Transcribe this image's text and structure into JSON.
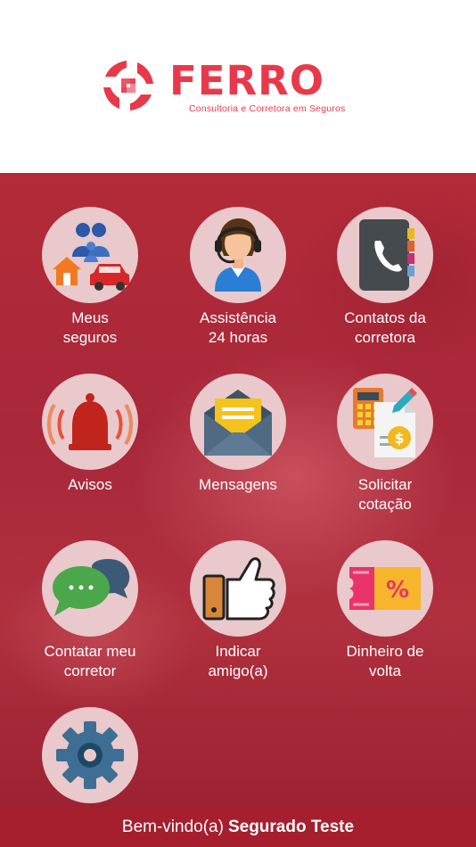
{
  "brand": {
    "name": "FERRO",
    "tagline": "Consultoria e Corretora em Seguros",
    "color": "#e8394a"
  },
  "menu": [
    {
      "line1": "Meus",
      "line2": "seguros",
      "icon": "family-house-car-icon"
    },
    {
      "line1": "Assistência",
      "line2": "24 horas",
      "icon": "headset-agent-icon"
    },
    {
      "line1": "Contatos da",
      "line2": "corretora",
      "icon": "phone-book-icon"
    },
    {
      "line1": "Avisos",
      "line2": "",
      "icon": "alarm-bell-icon"
    },
    {
      "line1": "Mensagens",
      "line2": "",
      "icon": "envelope-icon"
    },
    {
      "line1": "Solicitar",
      "line2": "cotação",
      "icon": "calculator-quote-icon"
    },
    {
      "line1": "Contatar meu",
      "line2": "corretor",
      "icon": "chat-bubbles-icon"
    },
    {
      "line1": "Indicar",
      "line2": "amigo(a)",
      "icon": "thumbs-up-icon"
    },
    {
      "line1": "Dinheiro de",
      "line2": "volta",
      "icon": "discount-ticket-icon"
    },
    {
      "line1": "",
      "line2": "",
      "icon": "gear-icon"
    }
  ],
  "footer": {
    "greeting": "Bem-vindo(a)",
    "user": "Segurado Teste",
    "background": "#a51f2e"
  }
}
